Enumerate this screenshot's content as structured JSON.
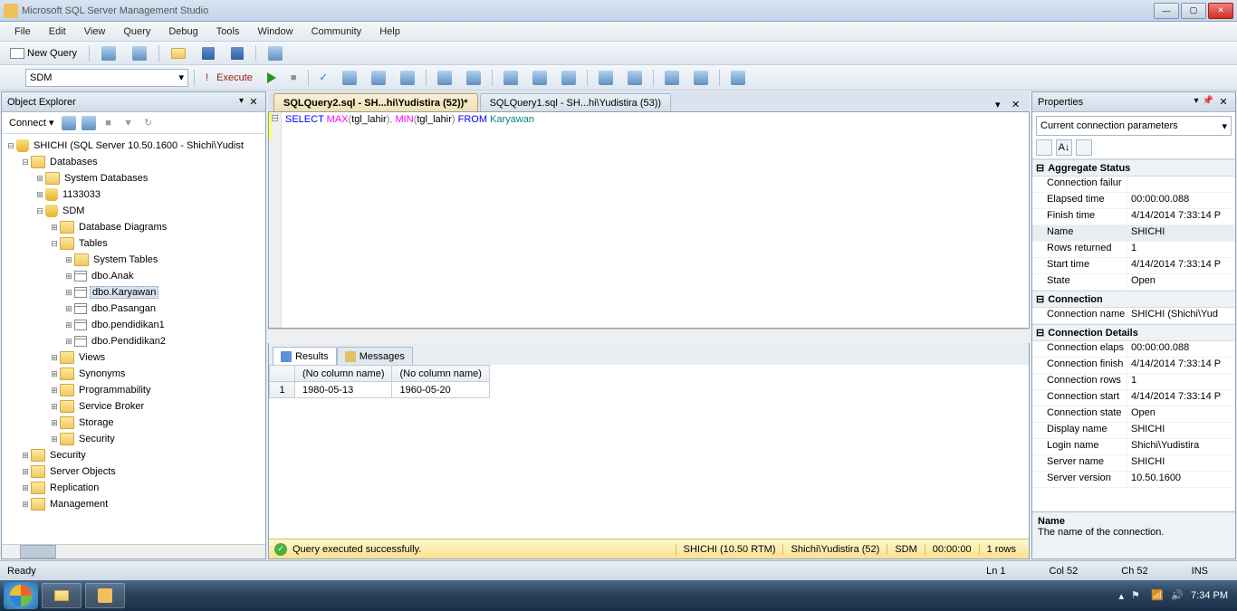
{
  "app": {
    "title": "Microsoft SQL Server Management Studio"
  },
  "menu": [
    "File",
    "Edit",
    "View",
    "Query",
    "Debug",
    "Tools",
    "Window",
    "Community",
    "Help"
  ],
  "toolbar1": {
    "new_query": "New Query"
  },
  "toolbar2": {
    "database": "SDM",
    "execute": "Execute",
    "debug": "▶"
  },
  "object_explorer": {
    "title": "Object Explorer",
    "connect": "Connect ▾",
    "root": "SHICHI (SQL Server 10.50.1600 - Shichi\\Yudist",
    "databases": "Databases",
    "sysdb": "System Databases",
    "db1": "1133033",
    "db2": "SDM",
    "diagrams": "Database Diagrams",
    "tables": "Tables",
    "systables": "System Tables",
    "t1": "dbo.Anak",
    "t2": "dbo.Karyawan",
    "t3": "dbo.Pasangan",
    "t4": "dbo.pendidikan1",
    "t5": "dbo.Pendidikan2",
    "views": "Views",
    "synonyms": "Synonyms",
    "prog": "Programmability",
    "svcbroker": "Service Broker",
    "storage": "Storage",
    "security": "Security",
    "security2": "Security",
    "serverobj": "Server Objects",
    "replication": "Replication",
    "management": "Management"
  },
  "tabs": {
    "active": "SQLQuery2.sql - SH...hi\\Yudistira (52))*",
    "inactive": "SQLQuery1.sql - SH...hi\\Yudistira (53))"
  },
  "sql": {
    "select": "SELECT ",
    "max": "MAX",
    "p1": "(",
    "col1": "tgl_lahir",
    "p2": ")",
    "comma": ", ",
    "min": "MIN",
    "p3": "(",
    "col2": "tgl_lahir",
    "p4": ") ",
    "from": "FROM ",
    "tbl": "Karyawan"
  },
  "results": {
    "tab_results": "Results",
    "tab_messages": "Messages",
    "col1": "(No column name)",
    "col2": "(No column name)",
    "row1": {
      "n": "1",
      "v1": "1980-05-13",
      "v2": "1960-05-20"
    }
  },
  "query_status": {
    "msg": "Query executed successfully.",
    "server": "SHICHI (10.50 RTM)",
    "user": "Shichi\\Yudistira (52)",
    "db": "SDM",
    "time": "00:00:00",
    "rows": "1 rows"
  },
  "properties": {
    "title": "Properties",
    "combo": "Current connection parameters",
    "cat1": "Aggregate Status",
    "rows1": [
      {
        "k": "Connection failur",
        "v": ""
      },
      {
        "k": "Elapsed time",
        "v": "00:00:00.088"
      },
      {
        "k": "Finish time",
        "v": "4/14/2014 7:33:14 P"
      },
      {
        "k": "Name",
        "v": "SHICHI",
        "sel": true
      },
      {
        "k": "Rows returned",
        "v": "1"
      },
      {
        "k": "Start time",
        "v": "4/14/2014 7:33:14 P"
      },
      {
        "k": "State",
        "v": "Open"
      }
    ],
    "cat2": "Connection",
    "rows2": [
      {
        "k": "Connection name",
        "v": "SHICHI (Shichi\\Yud"
      }
    ],
    "cat3": "Connection Details",
    "rows3": [
      {
        "k": "Connection elaps",
        "v": "00:00:00.088"
      },
      {
        "k": "Connection finish",
        "v": "4/14/2014 7:33:14 P"
      },
      {
        "k": "Connection rows",
        "v": "1"
      },
      {
        "k": "Connection start",
        "v": "4/14/2014 7:33:14 P"
      },
      {
        "k": "Connection state",
        "v": "Open"
      },
      {
        "k": "Display name",
        "v": "SHICHI"
      },
      {
        "k": "Login name",
        "v": "Shichi\\Yudistira"
      },
      {
        "k": "Server name",
        "v": "SHICHI"
      },
      {
        "k": "Server version",
        "v": "10.50.1600"
      }
    ],
    "desc_name": "Name",
    "desc_text": "The name of the connection."
  },
  "status": {
    "ready": "Ready",
    "ln": "Ln 1",
    "col": "Col 52",
    "ch": "Ch 52",
    "ins": "INS"
  },
  "taskbar": {
    "time": "7:34 PM"
  }
}
